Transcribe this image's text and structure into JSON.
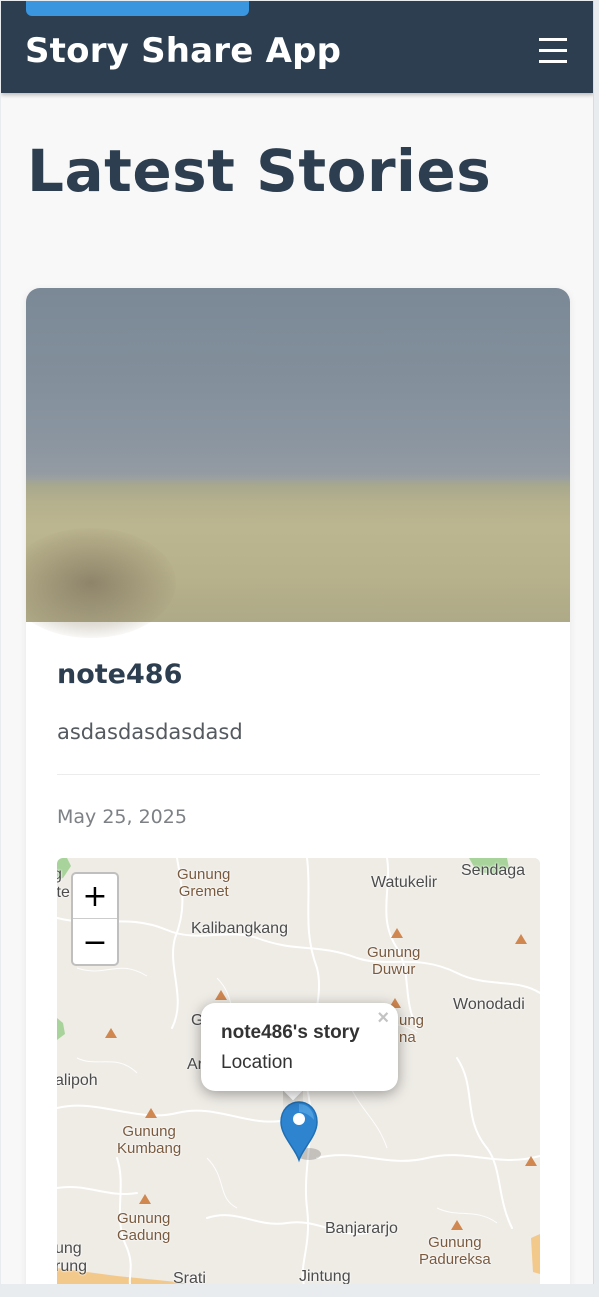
{
  "header": {
    "app_title": "Story Share App",
    "menu_icon": "hamburger-menu-icon"
  },
  "page": {
    "title": "Latest Stories"
  },
  "stories": [
    {
      "name": "note486",
      "description": "asdasdasdasdasd",
      "date": "May 25, 2025",
      "map": {
        "zoom_in_label": "+",
        "zoom_out_label": "−",
        "popup_title": "note486's story",
        "popup_body": "Location",
        "popup_close": "×",
        "place_labels": {
          "gremet": "Gunung\nGremet",
          "watukelir": "Watukelir",
          "sendaga": "Sendaga",
          "kalibangkang": "Kalibangkang",
          "duwur": "Gunung\nDuwur",
          "wonodadi": "Wonodadi",
          "alipoh": "alipoh",
          "kumbang": "Gunung\nKumbang",
          "gadung": "Gunung\nGadung",
          "banjararjo": "Banjararjo",
          "padureksa": "Gunung\nPadureksa",
          "srati": "Srati",
          "jintung": "Jintung",
          "ung_left": "ung\nrung",
          "ite_left": "g\nite",
          "ar_partial": "Ar",
          "g_partial": "G",
          "ung_na_partial": "ung\nna"
        }
      }
    }
  ],
  "colors": {
    "header_bg": "#2d3e50",
    "accent": "#3a96de",
    "title_text": "#2d3e50"
  }
}
